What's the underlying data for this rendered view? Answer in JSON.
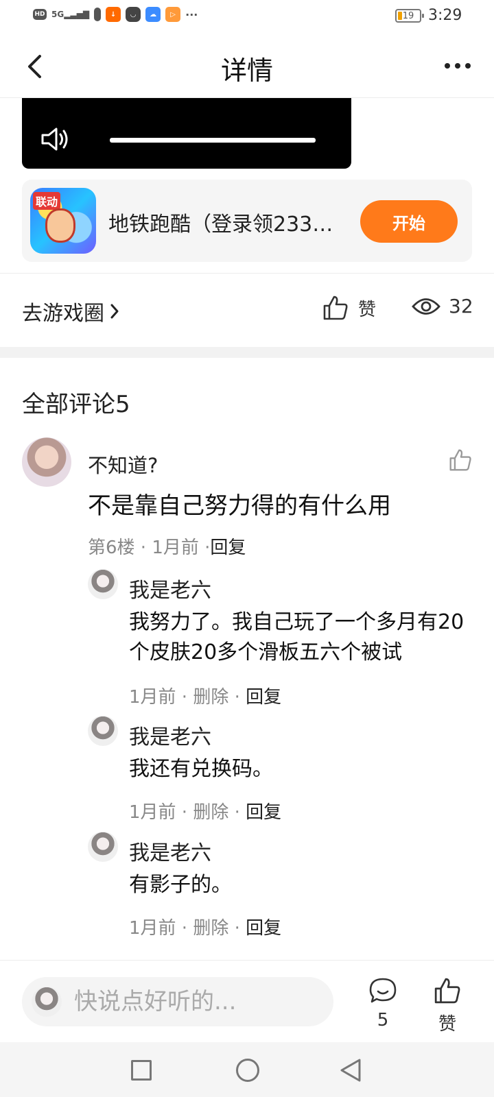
{
  "status_bar": {
    "hd": "HD",
    "net": "5G",
    "battery": "19",
    "time": "3:29",
    "more": "···"
  },
  "header": {
    "title": "详情"
  },
  "game_card": {
    "tag": "联动",
    "name": "地铁跑酷（登录领233…",
    "start_label": "开始"
  },
  "actions": {
    "go_circle": "去游戏圈",
    "like_label": "赞",
    "views": "32"
  },
  "comments_header": "全部评论5",
  "comment": {
    "user": "不知道?",
    "text": "不是靠自己努力得的有什么用",
    "floor": "第6楼",
    "time": "1月前",
    "reply": "回复",
    "replies": [
      {
        "user": "我是老六",
        "text": "我努力了。我自己玩了一个多月有20个皮肤20多个滑板五六个被试",
        "time": "1月前",
        "delete": "删除",
        "reply": "回复"
      },
      {
        "user": "我是老六",
        "text": "我还有兑换码。",
        "time": "1月前",
        "delete": "删除",
        "reply": "回复"
      },
      {
        "user": "我是老六",
        "text": "有影子的。",
        "time": "1月前",
        "delete": "删除",
        "reply": "回复"
      }
    ]
  },
  "bottom_bar": {
    "placeholder": "快说点好听的...",
    "comment_count": "5",
    "like_label": "赞"
  },
  "colors": {
    "accent": "#ff7a1a"
  }
}
